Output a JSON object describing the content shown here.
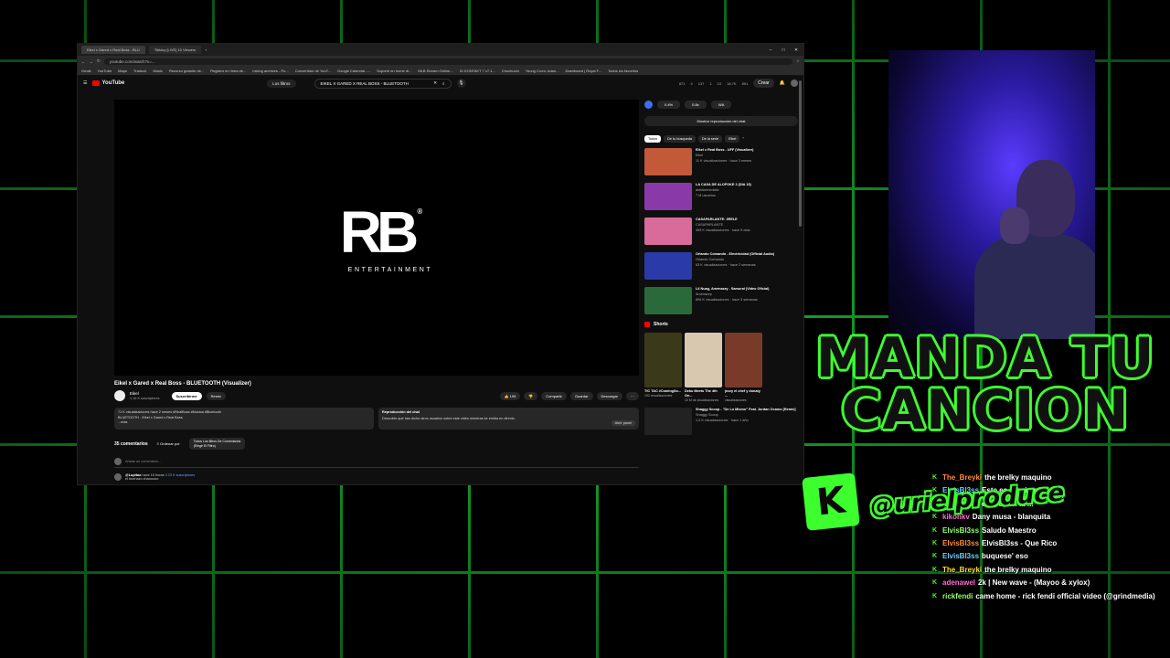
{
  "browser": {
    "tabs": [
      "Eikel x Gared x Real Boss - BLU",
      "Tiktoky [LIVE] 10 Viewers"
    ],
    "url": "youtube.com/watch?v=...",
    "bookmarks": [
      "Gmail",
      "YouTube",
      "Maps",
      "Traducir",
      "Music",
      "Recurso gratuito de...",
      "Registro en línea de...",
      "mixing archives - Pu...",
      "Convertidor de YouT...",
      "Google Calendar -...",
      "Soporte en home di...",
      "MLB Stream Online...",
      "IG KONTAKT 7 v7.1...",
      "Chuchuchi",
      "Young Crom, Adan...",
      "Dashboard | Royal F...",
      "Todos los favoritos"
    ]
  },
  "youtube": {
    "logo": "YouTube",
    "filter_chip": "Los filtros",
    "search_value": "EIKEL X GARED X REAL BOSS - BLUETOOTH",
    "topbar_stats": [
      "871",
      "4",
      "137",
      "1",
      "10",
      "18.7K",
      "891"
    ],
    "create_label": "Crear",
    "player": {
      "logo_text": "RB",
      "logo_sub": "ENTERTAINMENT"
    },
    "video_title": "Eikel x Gared x Real Boss - BLUETOOTH (Visualizer)",
    "channel_name": "Eikel",
    "subscribers": "1,16 K suscriptores",
    "subscribe_label": "Suscribirme",
    "remix_label": "Remix",
    "likes": "199",
    "share_label": "Compartir",
    "save_label": "Guardar",
    "download_label": "Descargar",
    "description": {
      "line1": "71 K visualizaciones  hace 2 meses  #RealBoss #Musica #Bluetooth",
      "line2": "BLUETOOTH - Eikel x Gared x Real Boss",
      "line3": "...más"
    },
    "chat_replay": {
      "title": "Reproducción del chat",
      "text": "Descubre qué han dicho otros usuarios sobre este video mientras se emitía en directo.",
      "open_label": "Abrir panel"
    },
    "comments": {
      "count": "35 comentarios",
      "sort_label": "Ordenar por",
      "filter_line1": "Todos Los filtros De Comentarios",
      "filter_line2": "(Elegir El Filtro)",
      "add_placeholder": "Añade un comentario...",
      "first_user": "@Lupitao",
      "first_time": "hace 10 horas",
      "first_tag": "3.23 K suscriptores",
      "first_text": "el buenazo chaooooo"
    }
  },
  "side": {
    "stats": [
      "0.4%",
      "0.8x",
      "N/A"
    ],
    "show_chat": "Mostrar reproducción del chat",
    "chips": [
      "Todos",
      "De tu búsqueda",
      "De la serie",
      "Eikel"
    ],
    "recs": [
      {
        "title": "Eikel x Real Boss - UFF (Visualizer)",
        "channel": "Eikel",
        "meta": "11 K visualizaciones · hace 3 meses",
        "color": "#c25a3a"
      },
      {
        "title": "LA CASA DE ALOFOKE 2 (DIA 15)",
        "channel": "alofokemediatv",
        "meta": "7 M usuarios",
        "color": "#8a3aa8"
      },
      {
        "title": "CASAPARLANTE: 3RELE",
        "channel": "CASAPARLANTE",
        "meta": "465 K visualizaciones · hace 5 días",
        "color": "#d86b9a"
      },
      {
        "title": "Orlando Comando - Electricidad (Official Audio)",
        "channel": "Orlando Comando",
        "meta": "63 K visualizaciones · hace 2 semanas",
        "color": "#2a3aa8"
      },
      {
        "title": "Lil Nuag, Amenazzy - Samurai (Video Oficial)",
        "channel": "Amenazzy",
        "meta": "896 K visualizaciones · hace 3 semanas",
        "color": "#2a6a3a"
      }
    ],
    "shorts_label": "Shorts",
    "shorts": [
      {
        "title": "TIC TAC #ComingSo...",
        "views": "192 visualizaciones",
        "color": "#3a3a1a"
      },
      {
        "title": "Deku Meets The 4th On...",
        "views": "10 M de visualizaciones",
        "color": "#d9c8b0"
      },
      {
        "title": "jezzy el chef y donaty ...",
        "views": "visualizaciones",
        "color": "#7a3a2a"
      }
    ],
    "last_rec": {
      "title": "Shaggy Scoop - \"De Lo Mismo\" Feat. Jordan Ocamo [Remix]",
      "channel": "Shaggy Scoop",
      "meta": "1,3 K visualizaciones · hace 1 año",
      "color": "#222"
    }
  },
  "overlay": {
    "line1": "MANDA TU",
    "line2": "CANCION",
    "kick_letter": "K",
    "handle": "@urielproduce",
    "brand_green": "#3dff2e"
  },
  "chat": [
    {
      "user": "The_Breyki",
      "text": "the brelky maquino"
    },
    {
      "user": "ElvisBl3ss",
      "text": "Este es el primer tema"
    },
    {
      "user": "ElvisBl3ss",
      "text": "este es en la ..."
    },
    {
      "user": "kikonkv",
      "text": "Dany musa - blanquita"
    },
    {
      "user": "ElvisBl3ss",
      "text": "Saludo Maestro"
    },
    {
      "user": "ElvisBl3ss",
      "text": "ElvisBl3ss - Que Rico"
    },
    {
      "user": "ElvisBl3ss",
      "text": "buquese' eso"
    },
    {
      "user": "The_Breyki",
      "text": "the brelky maquino"
    },
    {
      "user": "adenawel",
      "text": "2k | New wave - (Mayoo & xylox)"
    },
    {
      "user": "rickfendi",
      "text": "came home - rick fendi official video (@grindmedia)"
    }
  ]
}
